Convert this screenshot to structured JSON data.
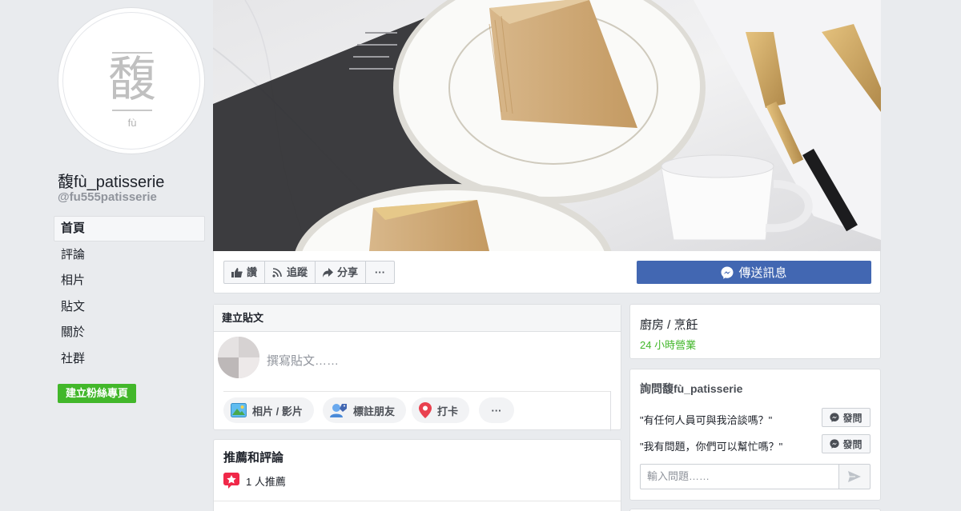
{
  "page": {
    "name": "馥fù_patisserie",
    "handle": "@fu555patisserie",
    "logo_glyph": "馥",
    "logo_sub": "fù"
  },
  "nav": {
    "items": [
      {
        "label": "首頁",
        "active": true
      },
      {
        "label": "評論"
      },
      {
        "label": "相片"
      },
      {
        "label": "貼文"
      },
      {
        "label": "關於"
      },
      {
        "label": "社群"
      }
    ],
    "create_fan_page": "建立粉絲專頁"
  },
  "actions": {
    "like": "讚",
    "follow": "追蹤",
    "share": "分享",
    "more": "···",
    "send_message": "傳送訊息"
  },
  "create_post": {
    "title": "建立貼文",
    "placeholder": "撰寫貼文……",
    "buttons": {
      "photo_video": "相片 / 影片",
      "tag_friends": "標註朋友",
      "check_in": "打卡",
      "more": "···"
    }
  },
  "reviews": {
    "title": "推薦和評論",
    "count_text": "1 人推薦"
  },
  "category": {
    "name": "廚房 / 烹飪",
    "hours": "24 小時營業"
  },
  "ask": {
    "title": "詢問馥fù_patisserie",
    "questions": [
      {
        "text": "\"有任何人員可與我洽談嗎？\"",
        "button": "發問"
      },
      {
        "text": "\"我有問題，你們可以幫忙嗎？\"",
        "button": "發問"
      }
    ],
    "input_placeholder": "輸入問題……"
  },
  "colors": {
    "brand_blue": "#4267b2",
    "green": "#42b72a",
    "background": "#e9ebee"
  }
}
